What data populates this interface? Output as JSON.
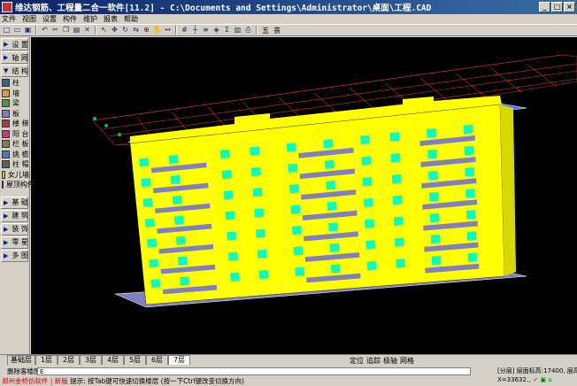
{
  "window": {
    "title": "维达钢筋、工程量二合一软件[11.2] - C:\\Documents and Settings\\Administrator\\桌面\\工程.CAD",
    "controls": [
      "_",
      "□",
      "×"
    ]
  },
  "menu": [
    "文件",
    "视图",
    "设置",
    "构件",
    "维护",
    "报表",
    "帮助"
  ],
  "toolbar": {
    "icons": [
      "new-icon",
      "open-icon",
      "save-icon",
      "undo-icon",
      "cut-icon",
      "copy-icon",
      "paste-icon",
      "delete-icon",
      "select-icon",
      "move-icon",
      "rotate-icon",
      "mirror-icon",
      "zoom-icon",
      "pan-icon",
      "measure-icon",
      "grid-icon",
      "axis-icon",
      "layer-icon",
      "view3d-icon",
      "calc-icon",
      "report-icon",
      "print-icon"
    ],
    "text_buttons": [
      "五",
      "丧"
    ]
  },
  "sidebar": {
    "groups": [
      {
        "label": "设 置",
        "items": []
      },
      {
        "label": "轴 网",
        "items": []
      },
      {
        "label": "结 构",
        "items": [
          "柱",
          "墙",
          "梁",
          "板",
          "楼 梯",
          "阳 台",
          "栏 板",
          "挑 檐",
          "柱 帽",
          "女儿墙",
          "屋顶构件"
        ]
      },
      {
        "label": "基 础",
        "items": []
      },
      {
        "label": "建 筑",
        "items": []
      },
      {
        "label": "装 饰",
        "items": []
      },
      {
        "label": "零 星",
        "items": []
      },
      {
        "label": "多 图",
        "items": []
      }
    ]
  },
  "floor_tabs": [
    "基础层",
    "1层",
    "2层",
    "3层",
    "4层",
    "5层",
    "6层",
    "7层"
  ],
  "active_floor": "7层",
  "bottom_tools": [
    "定位",
    "追踪",
    "极轴",
    "网格"
  ],
  "command": {
    "label": "删除客楼图",
    "input": "E",
    "hint_prefix": "郑州金桥仿软件 | 新版",
    "hint": "提示: 按Tab键可快速切换楼层 (按一下Ctrl键改变切换方向)"
  },
  "status": {
    "text": "[分层] 层面标高:17400, 层高:2900",
    "coord": "X=33632.,"
  },
  "colors": {
    "wall": "#ffff00",
    "window": "#00ffc0",
    "slab": "#8080c0",
    "roof_slab": "#3a7bff",
    "grid": "#c83232",
    "axis_green": "#00c040"
  }
}
